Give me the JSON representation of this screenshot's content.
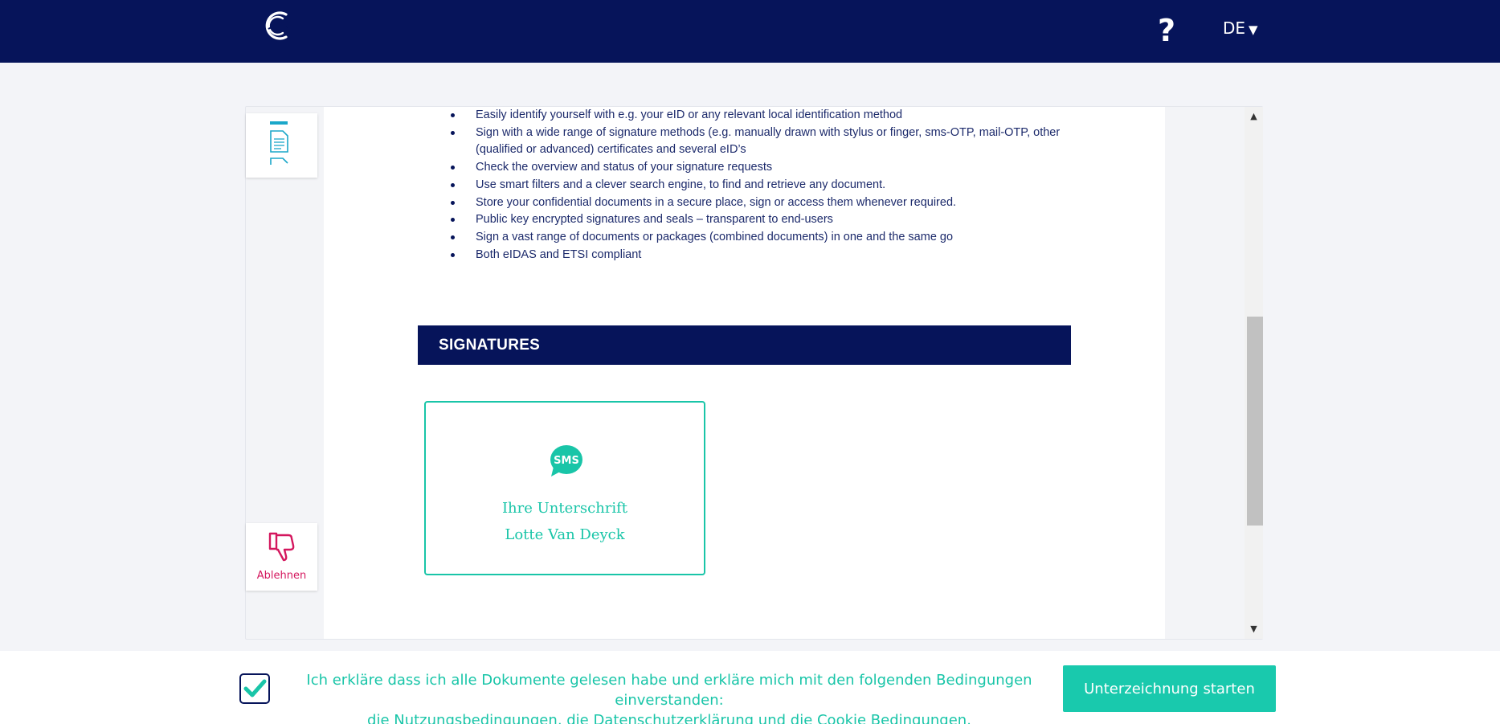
{
  "header": {
    "logo_icon": "brand-c-logo-icon",
    "help_label": "?",
    "language": "DE",
    "language_caret": "▼"
  },
  "sidebar": {
    "thumbnail_icon": "document-thumbnail-icon",
    "decline_icon": "thumbs-down-icon",
    "decline_label": "Ablehnen"
  },
  "document": {
    "bullets": [
      "Easily identify yourself with e.g. your eID or any relevant local identification method",
      "Sign with a wide range of signature methods (e.g. manually drawn with stylus or finger, sms-OTP, mail-OTP, other (qualified or advanced) certificates and several eID’s",
      "Check the overview and status of your signature requests",
      "Use smart filters and a clever search engine, to find and retrieve any document.",
      "Store your confidential documents in a secure place, sign or access them whenever required.",
      "Public key encrypted signatures and seals – transparent to end-users",
      "Sign a vast range of documents or packages (combined documents) in one and the same go",
      "Both eIDAS and ETSI compliant"
    ],
    "section_title": "SIGNATURES",
    "signature_field": {
      "icon": "sms-bubble-icon",
      "icon_text": "SMS",
      "label": "Ihre Unterschrift",
      "signer": "Lotte Van Deyck"
    }
  },
  "scrollbar": {
    "up_arrow": "▲",
    "down_arrow": "▼"
  },
  "footer": {
    "checkbox_checked": true,
    "consent_text": "Ich erkläre dass ich alle Dokumente gelesen habe und erkläre mich mit den folgenden Bedingungen einverstanden:",
    "terms_link": "die Nutzungsbedingungen",
    "comma": ",",
    "privacy_link": "die Datenschutzerklärung",
    "and_text": "und",
    "cookie_link": "die Cookie Bedingungen",
    "period": ".",
    "start_button": "Unterzeichnung starten"
  },
  "colors": {
    "navy": "#06145a",
    "teal": "#19c5a8",
    "decline": "#d4175e"
  }
}
